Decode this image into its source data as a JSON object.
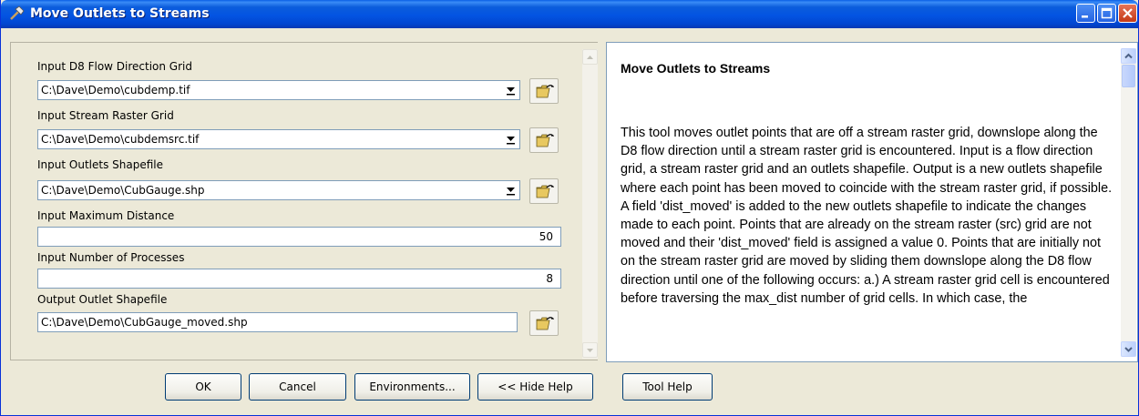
{
  "window": {
    "title": "Move Outlets to Streams"
  },
  "form": {
    "d8_label": "Input D8 Flow Direction Grid",
    "d8_value": "C:\\Dave\\Demo\\cubdemp.tif",
    "stream_label": "Input Stream Raster Grid",
    "stream_value": "C:\\Dave\\Demo\\cubdemsrc.tif",
    "outlets_label": "Input Outlets Shapefile",
    "outlets_value": "C:\\Dave\\Demo\\CubGauge.shp",
    "maxdist_label": "Input Maximum Distance",
    "maxdist_value": "50",
    "procs_label": "Input Number of Processes",
    "procs_value": "8",
    "output_label": "Output Outlet Shapefile",
    "output_value": "C:\\Dave\\Demo\\CubGauge_moved.shp"
  },
  "help": {
    "title": "Move Outlets to Streams",
    "body": "This tool moves outlet points that are off a stream raster grid, downslope along the D8 flow direction until a stream raster grid is encountered. Input is a flow direction grid, a stream raster grid and an outlets shapefile. Output is a new outlets shapefile where each point has been moved to coincide with the stream raster grid, if possible. A field 'dist_moved' is added to the new outlets shapefile to indicate the changes made to each point. Points that are already on the stream raster (src) grid are not moved and their 'dist_moved' field is assigned a value 0. Points that are initially not on the stream raster grid are moved by sliding them downslope along the D8 flow direction until one of the following occurs: a.) A stream raster grid cell is encountered before traversing the max_dist number of grid cells. In which case, the"
  },
  "buttons": {
    "ok": "OK",
    "cancel": "Cancel",
    "environments": "Environments...",
    "hide_help": "<< Hide Help",
    "tool_help": "Tool Help"
  },
  "icons": {
    "title": "hammer-icon",
    "browse": "open-folder-icon"
  }
}
